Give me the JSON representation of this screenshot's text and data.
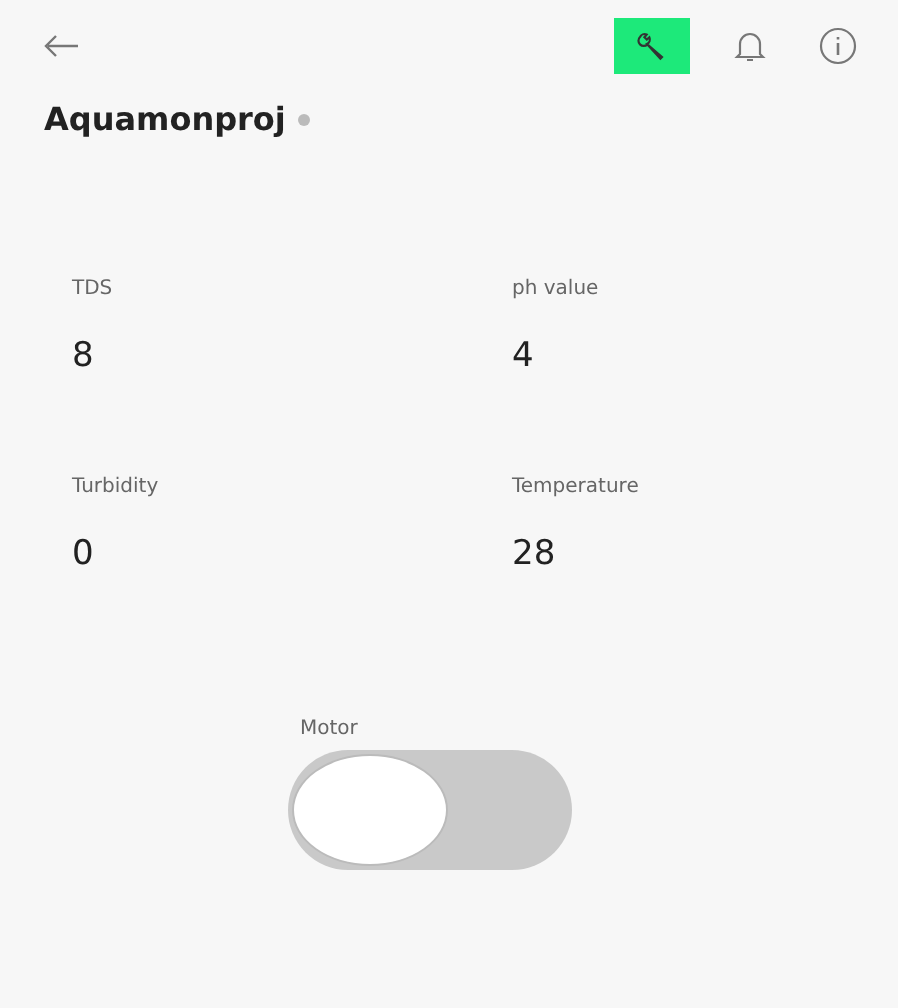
{
  "device": {
    "name": "Aquamonproj",
    "online": false
  },
  "toolbar": {
    "settings_active": true
  },
  "metrics": [
    {
      "label": "TDS",
      "value": "8"
    },
    {
      "label": "ph value",
      "value": "4"
    },
    {
      "label": "Turbidity",
      "value": "0"
    },
    {
      "label": "Temperature",
      "value": "28"
    }
  ],
  "switch": {
    "label": "Motor",
    "on": false
  }
}
